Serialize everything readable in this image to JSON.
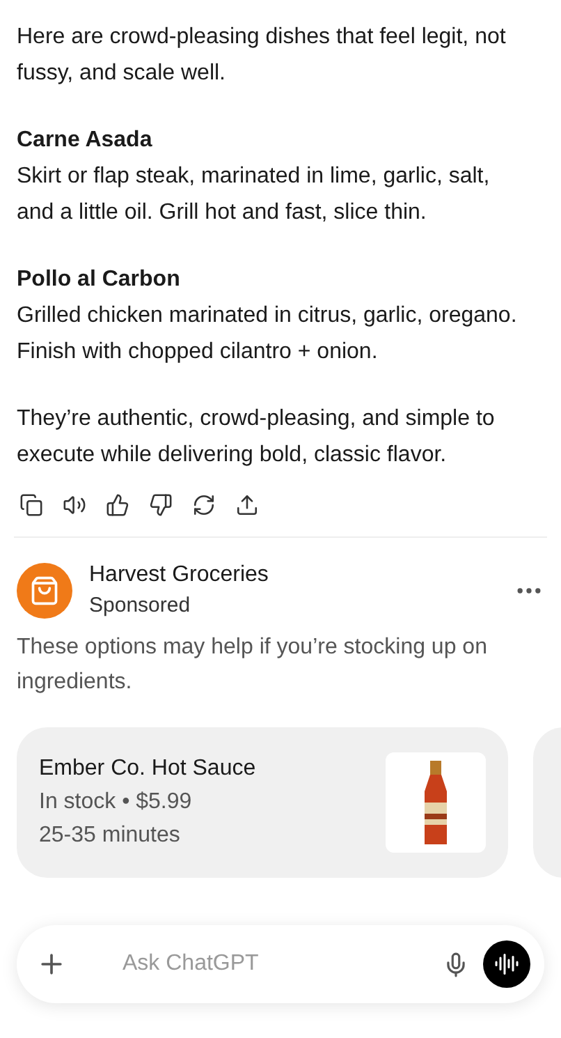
{
  "message": {
    "paragraphs": [
      {
        "body": "Here are crowd-pleasing dishes that feel legit, not fussy, and scale well."
      },
      {
        "title": "Carne Asada",
        "body": "Skirt or flap steak, marinated in lime, garlic, salt, and a little oil. Grill hot and fast, slice thin."
      },
      {
        "title": "Pollo al Carbon",
        "body": "Grilled chicken marinated in citrus, garlic, oregano. Finish with chopped cilantro + onion."
      },
      {
        "body": "They’re authentic, crowd-pleasing, and simple to execute while delivering bold, classic flavor."
      }
    ]
  },
  "actions": [
    {
      "kind": "copy"
    },
    {
      "kind": "speaker"
    },
    {
      "kind": "like"
    },
    {
      "kind": "dislike"
    },
    {
      "kind": "regenerate"
    },
    {
      "kind": "share"
    }
  ],
  "sponsor": {
    "name": "Harvest Groceries",
    "label": "Sponsored",
    "description": "These options may help if you’re stocking up on ingredients."
  },
  "products": [
    {
      "name": "Ember Co. Hot Sauce",
      "availability": "In stock • $5.99",
      "delivery": "25-35 minutes"
    }
  ],
  "composer": {
    "placeholder": "Ask ChatGPT"
  }
}
